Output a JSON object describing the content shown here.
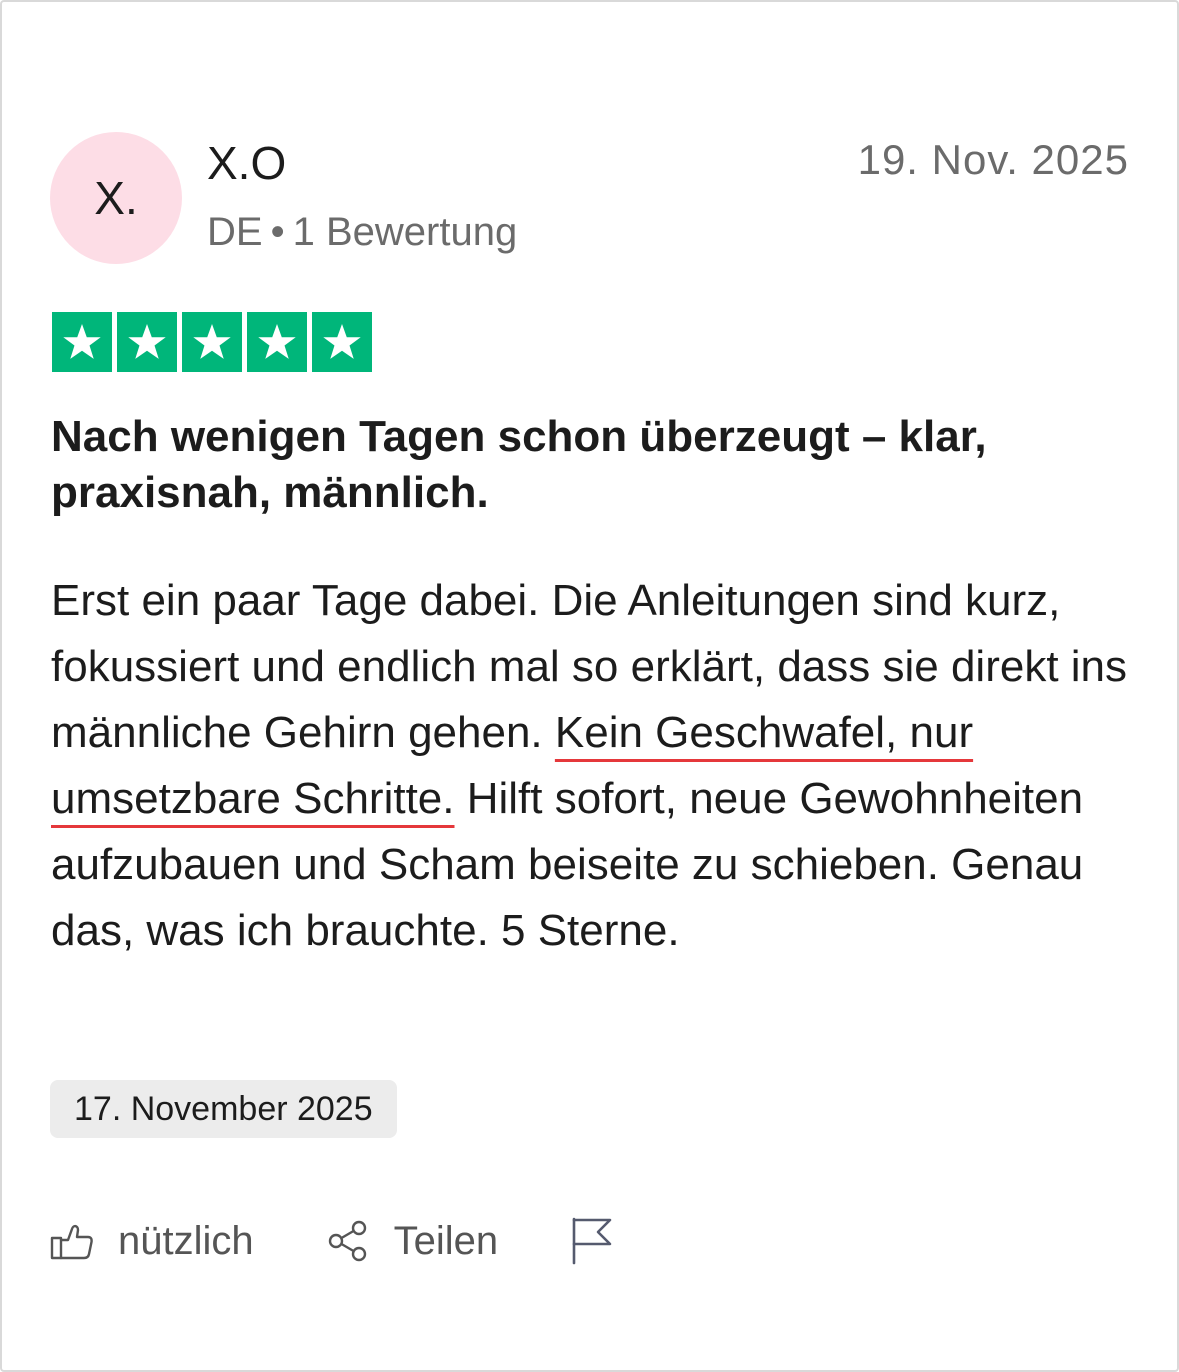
{
  "reviewer": {
    "avatar_initials": "X.",
    "avatar_color": "#fddde6",
    "name": "X.O",
    "country": "DE",
    "separator": "•",
    "review_count": "1 Bewertung"
  },
  "review": {
    "date_posted": "19. Nov. 2025",
    "rating": 5,
    "rating_max": 5,
    "star_color": "#00b67a",
    "title": "Nach wenigen Tagen schon überzeugt – klar, praxisnah, männlich.",
    "body_before": "Erst ein paar Tage dabei. Die Anleitungen sind kurz, fokussiert und endlich mal so erklärt, dass sie direkt ins männliche Gehirn gehen. ",
    "body_highlight": "Kein Geschwafel, nur umsetzbare Schritte.",
    "body_after": " Hilft sofort, neue Gewohnheiten aufzubauen und Scham beiseite zu schieben. Genau das, was ich brauchte. 5 Sterne.",
    "highlight_color": "#e5383b",
    "experience_date": "17. November 2025"
  },
  "actions": {
    "useful_label": "nützlich",
    "useful_icon": "thumbs-up-icon",
    "share_label": "Teilen",
    "share_icon": "share-icon",
    "report_icon": "flag-icon"
  }
}
